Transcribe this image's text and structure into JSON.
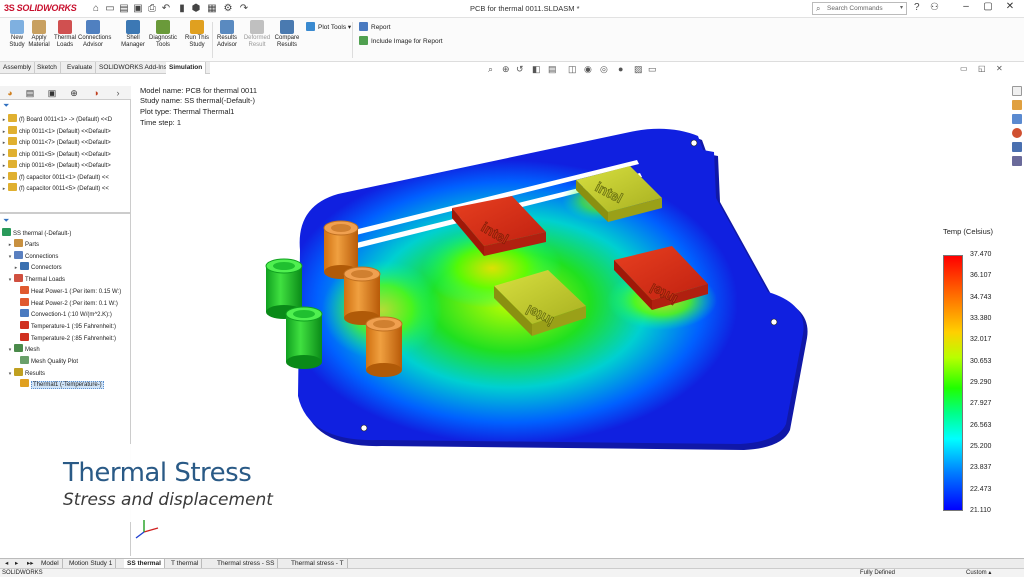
{
  "app": {
    "logo": "SOLIDWORKS",
    "document_title": "PCB for thermal 0011.SLDASM *",
    "search_placeholder": "Search Commands"
  },
  "ribbon": {
    "buttons": [
      {
        "label": "New\nStudy",
        "icon": "new-study-icon",
        "color": "#7fb0e0"
      },
      {
        "label": "Apply\nMaterial",
        "icon": "apply-material-icon",
        "color": "#c8a060"
      },
      {
        "label": "Thermal\nLoads",
        "icon": "thermal-loads-icon",
        "color": "#d05050"
      },
      {
        "label": "Connections\nAdvisor",
        "icon": "connections-advisor-icon",
        "color": "#5080c0"
      },
      {
        "label": "Shell\nManager",
        "icon": "shell-manager-icon",
        "color": "#3c78b4"
      },
      {
        "label": "Diagnostic\nTools",
        "icon": "diagnostic-tools-icon",
        "color": "#6a9a3a"
      },
      {
        "label": "Run This\nStudy",
        "icon": "run-study-icon",
        "color": "#e0a020"
      },
      {
        "label": "Results\nAdvisor",
        "icon": "results-advisor-icon",
        "color": "#5a8ac0"
      },
      {
        "label": "Deformed\nResult",
        "icon": "deformed-result-icon",
        "color": "#c0c0c0",
        "disabled": true
      },
      {
        "label": "Compare\nResults",
        "icon": "compare-results-icon",
        "color": "#4a7ab0"
      }
    ],
    "plot_tools": "Plot Tools",
    "report": "Report",
    "include_image": "Include Image for Report"
  },
  "command_tabs": [
    {
      "label": "Assembly"
    },
    {
      "label": "Sketch"
    },
    {
      "label": "Evaluate"
    },
    {
      "label": "SOLIDWORKS Add-Ins"
    },
    {
      "label": "Simulation",
      "active": true
    }
  ],
  "feature_tree": [
    {
      "label": "(f) Board 0011<1> -> (Default) <<D",
      "icon": "part-icon"
    },
    {
      "label": "chip 0011<1> (Default) <<Default>",
      "icon": "part-icon"
    },
    {
      "label": "chip 0011<7> (Default) <<Default>",
      "icon": "part-icon"
    },
    {
      "label": "chip 0011<5> (Default) <<Default>",
      "icon": "part-icon"
    },
    {
      "label": "chip 0011<6> (Default) <<Default>",
      "icon": "part-icon"
    },
    {
      "label": "(f) capacitor 0011<1> (Default) <<",
      "icon": "part-icon"
    },
    {
      "label": "(f) capacitor 0011<5> (Default) <<",
      "icon": "part-icon"
    }
  ],
  "study_tree": {
    "root": "SS thermal (-Default-)",
    "items": [
      {
        "label": "Parts",
        "indent": 1,
        "arrow": "▸"
      },
      {
        "label": "Connections",
        "indent": 1,
        "arrow": "▾"
      },
      {
        "label": "Connectors",
        "indent": 2,
        "arrow": "▸"
      },
      {
        "label": "Thermal Loads",
        "indent": 1,
        "arrow": "▾"
      },
      {
        "label": "Heat Power-1 (:Per item: 0.15 W:)",
        "indent": 2,
        "arrow": ""
      },
      {
        "label": "Heat Power-2 (:Per item: 0.1 W:)",
        "indent": 2,
        "arrow": ""
      },
      {
        "label": "Convection-1 (:10 W/(m^2.K):)",
        "indent": 2,
        "arrow": ""
      },
      {
        "label": "Temperature-1 (:95 Fahrenheit:)",
        "indent": 2,
        "arrow": ""
      },
      {
        "label": "Temperature-2 (:85 Fahrenheit:)",
        "indent": 2,
        "arrow": ""
      },
      {
        "label": "Mesh",
        "indent": 1,
        "arrow": "▾"
      },
      {
        "label": "Mesh Quality Plot",
        "indent": 2,
        "arrow": ""
      },
      {
        "label": "Results",
        "indent": 1,
        "arrow": "▾"
      },
      {
        "label": "Thermal1 (-Temperature-)",
        "indent": 2,
        "arrow": "",
        "selected": true
      }
    ]
  },
  "model_info": {
    "model_name": "Model name: PCB for thermal 0011",
    "study_name": "Study name: SS thermal(-Default-)",
    "plot_type": "Plot type: Thermal Thermal1",
    "time_step": "Time step: 1"
  },
  "legend": {
    "title": "Temp (Celsius)",
    "values": [
      "37.470",
      "36.107",
      "34.743",
      "33.380",
      "32.017",
      "30.653",
      "29.290",
      "27.927",
      "26.563",
      "25.200",
      "23.837",
      "22.473",
      "21.110"
    ]
  },
  "chip_label": "intel",
  "overlay": {
    "title": "Thermal Stress",
    "subtitle": "Stress and displacement"
  },
  "bottom_tabs": [
    {
      "label": "Model"
    },
    {
      "label": "Motion Study 1"
    },
    {
      "label": "SS thermal",
      "active": true
    },
    {
      "label": "T thermal"
    },
    {
      "label": "Thermal stress - SS"
    },
    {
      "label": "Thermal stress - T"
    }
  ],
  "status": {
    "left": "SOLIDWORKS",
    "fully_defined": "Fully Defined",
    "units": "Custom"
  }
}
